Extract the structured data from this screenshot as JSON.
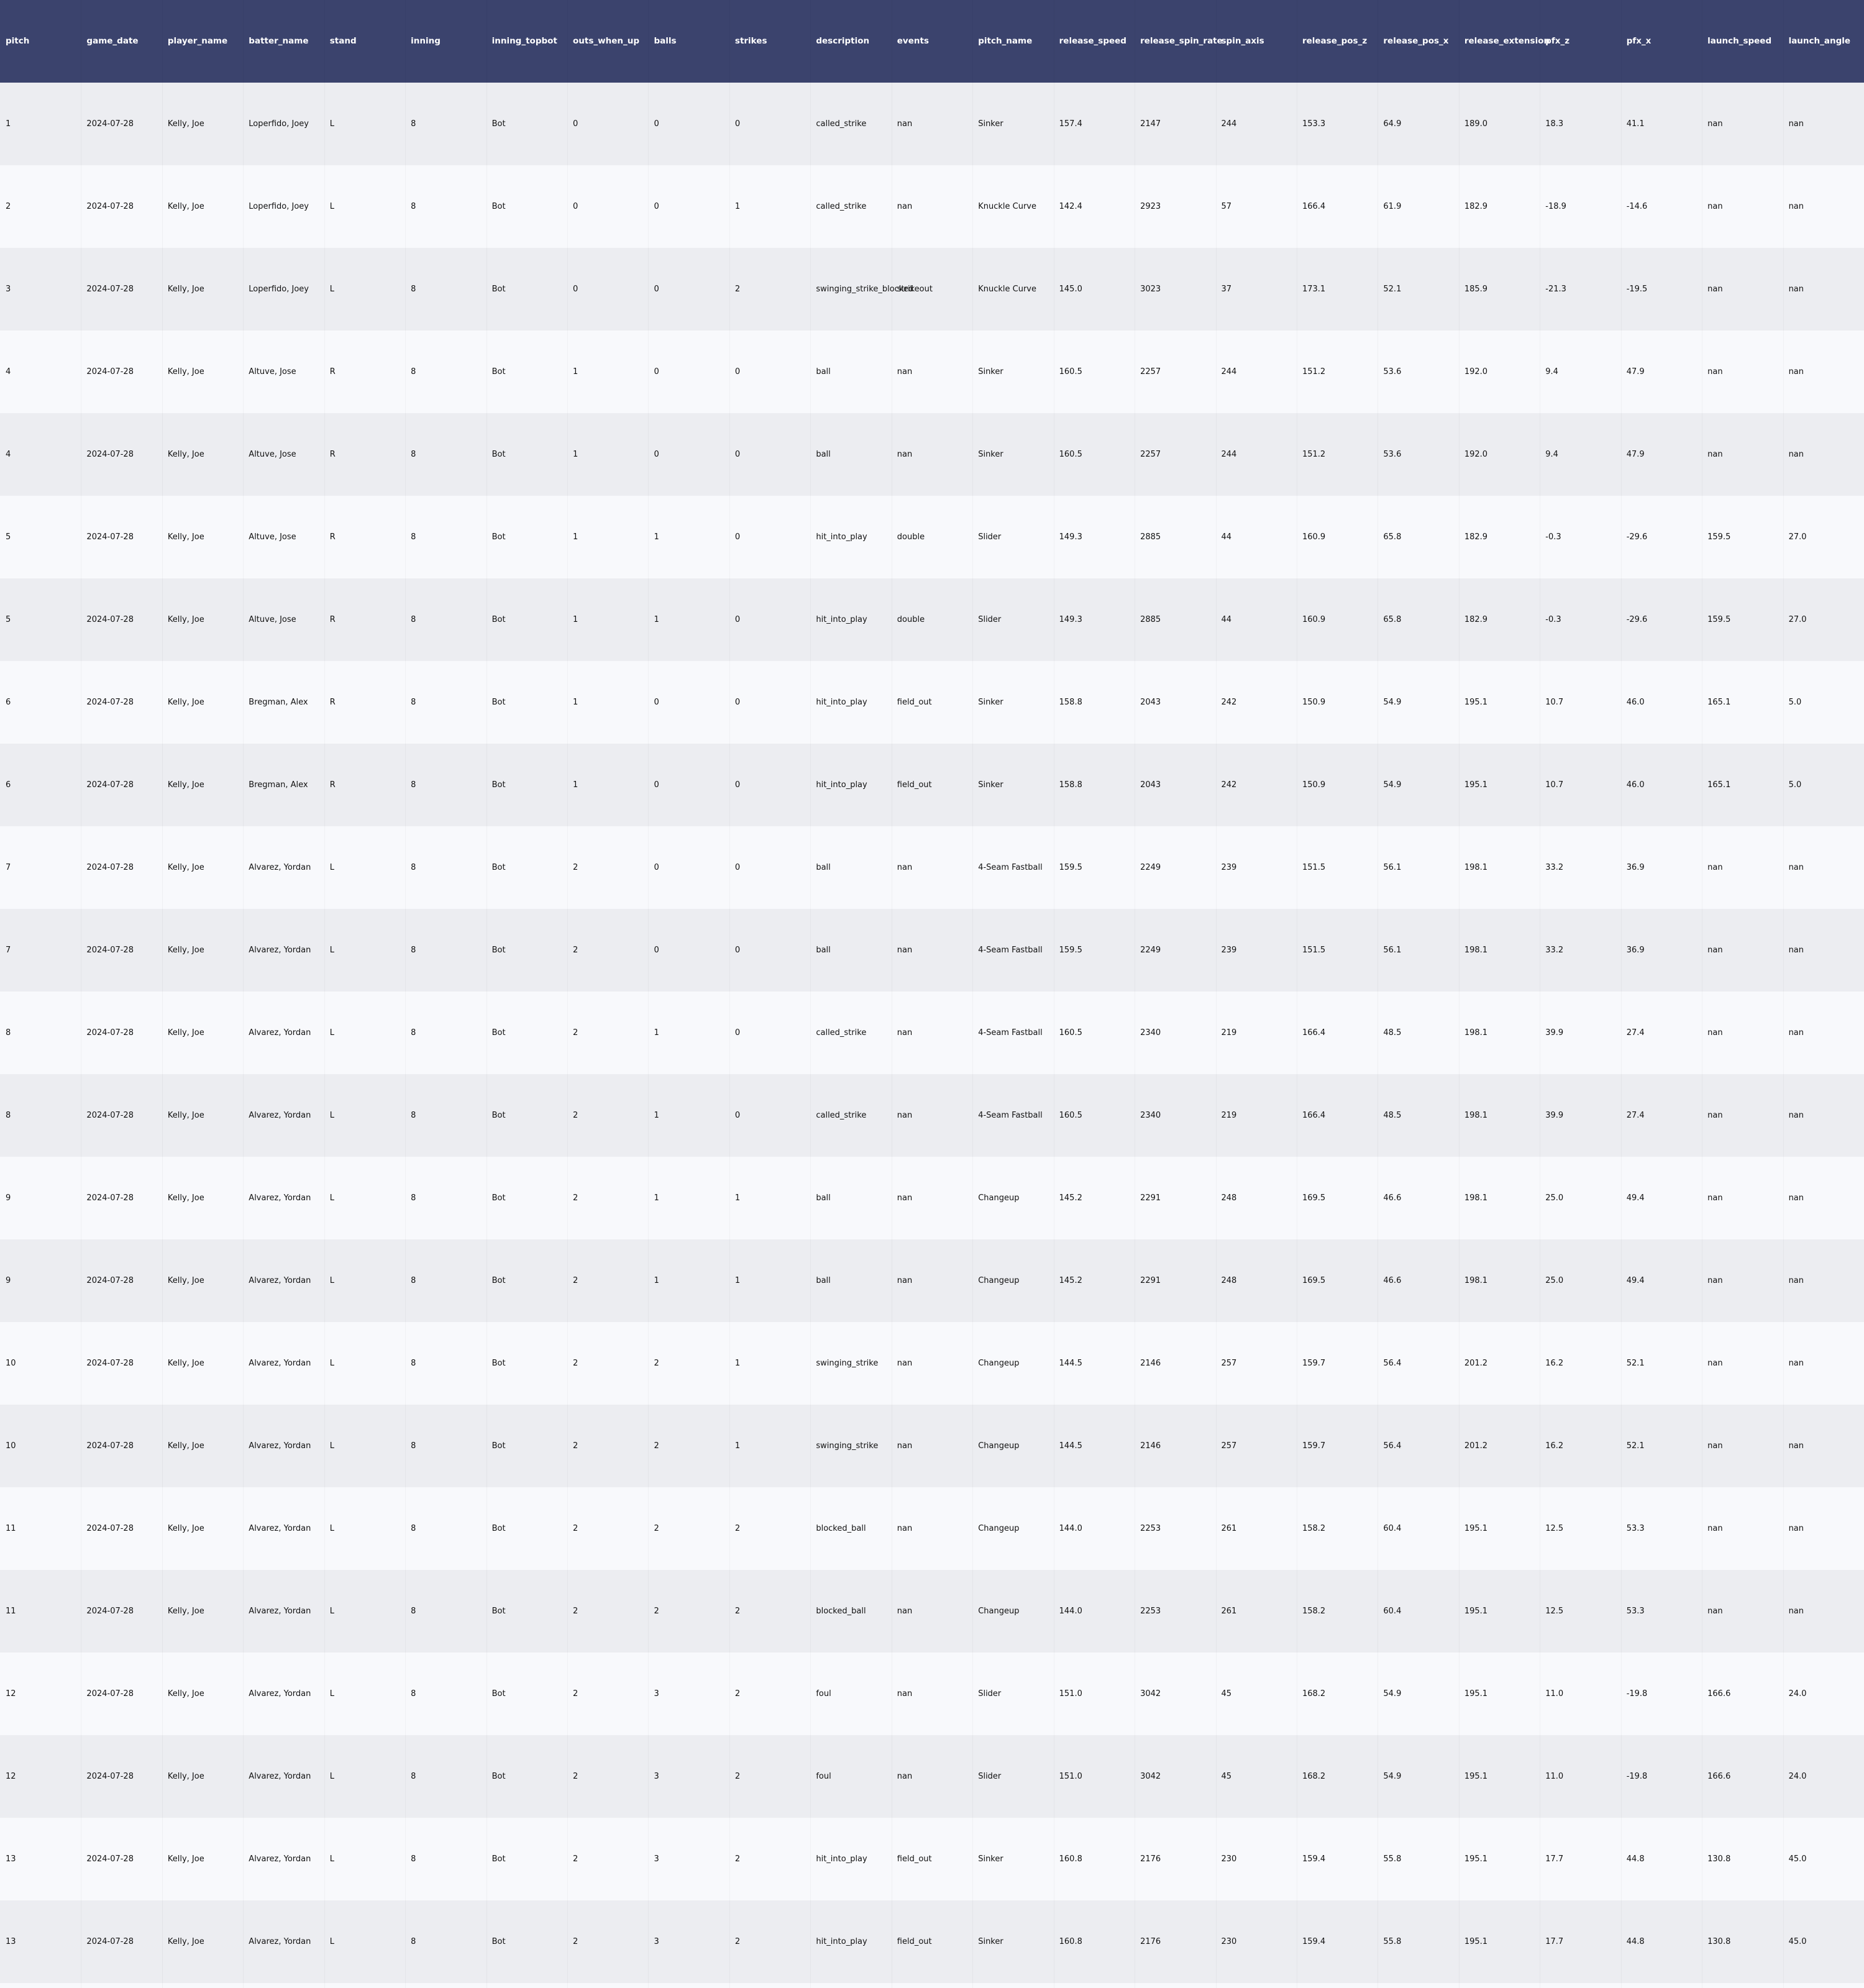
{
  "table": {
    "columns": [
      "pitch",
      "game_date",
      "player_name",
      "batter_name",
      "stand",
      "inning",
      "inning_topbot",
      "outs_when_up",
      "balls",
      "strikes",
      "description",
      "events",
      "pitch_name",
      "release_speed",
      "release_spin_rate",
      "spin_axis",
      "release_pos_z",
      "release_pos_x",
      "release_extension",
      "pfx_z",
      "pfx_x",
      "launch_speed",
      "launch_angle"
    ],
    "rows": [
      [
        "1",
        "2024-07-28",
        "Kelly, Joe",
        "Loperfido, Joey",
        "L",
        "8",
        "Bot",
        "0",
        "0",
        "0",
        "called_strike",
        "nan",
        "Sinker",
        "157.4",
        "2147",
        "244",
        "153.3",
        "64.9",
        "189.0",
        "18.3",
        "41.1",
        "nan",
        "nan"
      ],
      [
        "2",
        "2024-07-28",
        "Kelly, Joe",
        "Loperfido, Joey",
        "L",
        "8",
        "Bot",
        "0",
        "0",
        "1",
        "called_strike",
        "nan",
        "Knuckle Curve",
        "142.4",
        "2923",
        "57",
        "166.4",
        "61.9",
        "182.9",
        "-18.9",
        "-14.6",
        "nan",
        "nan"
      ],
      [
        "3",
        "2024-07-28",
        "Kelly, Joe",
        "Loperfido, Joey",
        "L",
        "8",
        "Bot",
        "0",
        "0",
        "2",
        "swinging_strike_blocked",
        "strikeout",
        "Knuckle Curve",
        "145.0",
        "3023",
        "37",
        "173.1",
        "52.1",
        "185.9",
        "-21.3",
        "-19.5",
        "nan",
        "nan"
      ],
      [
        "4",
        "2024-07-28",
        "Kelly, Joe",
        "Altuve, Jose",
        "R",
        "8",
        "Bot",
        "1",
        "0",
        "0",
        "ball",
        "nan",
        "Sinker",
        "160.5",
        "2257",
        "244",
        "151.2",
        "53.6",
        "192.0",
        "9.4",
        "47.9",
        "nan",
        "nan"
      ],
      [
        "4",
        "2024-07-28",
        "Kelly, Joe",
        "Altuve, Jose",
        "R",
        "8",
        "Bot",
        "1",
        "0",
        "0",
        "ball",
        "nan",
        "Sinker",
        "160.5",
        "2257",
        "244",
        "151.2",
        "53.6",
        "192.0",
        "9.4",
        "47.9",
        "nan",
        "nan"
      ],
      [
        "5",
        "2024-07-28",
        "Kelly, Joe",
        "Altuve, Jose",
        "R",
        "8",
        "Bot",
        "1",
        "1",
        "0",
        "hit_into_play",
        "double",
        "Slider",
        "149.3",
        "2885",
        "44",
        "160.9",
        "65.8",
        "182.9",
        "-0.3",
        "-29.6",
        "159.5",
        "27.0"
      ],
      [
        "5",
        "2024-07-28",
        "Kelly, Joe",
        "Altuve, Jose",
        "R",
        "8",
        "Bot",
        "1",
        "1",
        "0",
        "hit_into_play",
        "double",
        "Slider",
        "149.3",
        "2885",
        "44",
        "160.9",
        "65.8",
        "182.9",
        "-0.3",
        "-29.6",
        "159.5",
        "27.0"
      ],
      [
        "6",
        "2024-07-28",
        "Kelly, Joe",
        "Bregman, Alex",
        "R",
        "8",
        "Bot",
        "1",
        "0",
        "0",
        "hit_into_play",
        "field_out",
        "Sinker",
        "158.8",
        "2043",
        "242",
        "150.9",
        "54.9",
        "195.1",
        "10.7",
        "46.0",
        "165.1",
        "5.0"
      ],
      [
        "6",
        "2024-07-28",
        "Kelly, Joe",
        "Bregman, Alex",
        "R",
        "8",
        "Bot",
        "1",
        "0",
        "0",
        "hit_into_play",
        "field_out",
        "Sinker",
        "158.8",
        "2043",
        "242",
        "150.9",
        "54.9",
        "195.1",
        "10.7",
        "46.0",
        "165.1",
        "5.0"
      ],
      [
        "7",
        "2024-07-28",
        "Kelly, Joe",
        "Alvarez, Yordan",
        "L",
        "8",
        "Bot",
        "2",
        "0",
        "0",
        "ball",
        "nan",
        "4-Seam Fastball",
        "159.5",
        "2249",
        "239",
        "151.5",
        "56.1",
        "198.1",
        "33.2",
        "36.9",
        "nan",
        "nan"
      ],
      [
        "7",
        "2024-07-28",
        "Kelly, Joe",
        "Alvarez, Yordan",
        "L",
        "8",
        "Bot",
        "2",
        "0",
        "0",
        "ball",
        "nan",
        "4-Seam Fastball",
        "159.5",
        "2249",
        "239",
        "151.5",
        "56.1",
        "198.1",
        "33.2",
        "36.9",
        "nan",
        "nan"
      ],
      [
        "8",
        "2024-07-28",
        "Kelly, Joe",
        "Alvarez, Yordan",
        "L",
        "8",
        "Bot",
        "2",
        "1",
        "0",
        "called_strike",
        "nan",
        "4-Seam Fastball",
        "160.5",
        "2340",
        "219",
        "166.4",
        "48.5",
        "198.1",
        "39.9",
        "27.4",
        "nan",
        "nan"
      ],
      [
        "8",
        "2024-07-28",
        "Kelly, Joe",
        "Alvarez, Yordan",
        "L",
        "8",
        "Bot",
        "2",
        "1",
        "0",
        "called_strike",
        "nan",
        "4-Seam Fastball",
        "160.5",
        "2340",
        "219",
        "166.4",
        "48.5",
        "198.1",
        "39.9",
        "27.4",
        "nan",
        "nan"
      ],
      [
        "9",
        "2024-07-28",
        "Kelly, Joe",
        "Alvarez, Yordan",
        "L",
        "8",
        "Bot",
        "2",
        "1",
        "1",
        "ball",
        "nan",
        "Changeup",
        "145.2",
        "2291",
        "248",
        "169.5",
        "46.6",
        "198.1",
        "25.0",
        "49.4",
        "nan",
        "nan"
      ],
      [
        "9",
        "2024-07-28",
        "Kelly, Joe",
        "Alvarez, Yordan",
        "L",
        "8",
        "Bot",
        "2",
        "1",
        "1",
        "ball",
        "nan",
        "Changeup",
        "145.2",
        "2291",
        "248",
        "169.5",
        "46.6",
        "198.1",
        "25.0",
        "49.4",
        "nan",
        "nan"
      ],
      [
        "10",
        "2024-07-28",
        "Kelly, Joe",
        "Alvarez, Yordan",
        "L",
        "8",
        "Bot",
        "2",
        "2",
        "1",
        "swinging_strike",
        "nan",
        "Changeup",
        "144.5",
        "2146",
        "257",
        "159.7",
        "56.4",
        "201.2",
        "16.2",
        "52.1",
        "nan",
        "nan"
      ],
      [
        "10",
        "2024-07-28",
        "Kelly, Joe",
        "Alvarez, Yordan",
        "L",
        "8",
        "Bot",
        "2",
        "2",
        "1",
        "swinging_strike",
        "nan",
        "Changeup",
        "144.5",
        "2146",
        "257",
        "159.7",
        "56.4",
        "201.2",
        "16.2",
        "52.1",
        "nan",
        "nan"
      ],
      [
        "11",
        "2024-07-28",
        "Kelly, Joe",
        "Alvarez, Yordan",
        "L",
        "8",
        "Bot",
        "2",
        "2",
        "2",
        "blocked_ball",
        "nan",
        "Changeup",
        "144.0",
        "2253",
        "261",
        "158.2",
        "60.4",
        "195.1",
        "12.5",
        "53.3",
        "nan",
        "nan"
      ],
      [
        "11",
        "2024-07-28",
        "Kelly, Joe",
        "Alvarez, Yordan",
        "L",
        "8",
        "Bot",
        "2",
        "2",
        "2",
        "blocked_ball",
        "nan",
        "Changeup",
        "144.0",
        "2253",
        "261",
        "158.2",
        "60.4",
        "195.1",
        "12.5",
        "53.3",
        "nan",
        "nan"
      ],
      [
        "12",
        "2024-07-28",
        "Kelly, Joe",
        "Alvarez, Yordan",
        "L",
        "8",
        "Bot",
        "2",
        "3",
        "2",
        "foul",
        "nan",
        "Slider",
        "151.0",
        "3042",
        "45",
        "168.2",
        "54.9",
        "195.1",
        "11.0",
        "-19.8",
        "166.6",
        "24.0"
      ],
      [
        "12",
        "2024-07-28",
        "Kelly, Joe",
        "Alvarez, Yordan",
        "L",
        "8",
        "Bot",
        "2",
        "3",
        "2",
        "foul",
        "nan",
        "Slider",
        "151.0",
        "3042",
        "45",
        "168.2",
        "54.9",
        "195.1",
        "11.0",
        "-19.8",
        "166.6",
        "24.0"
      ],
      [
        "13",
        "2024-07-28",
        "Kelly, Joe",
        "Alvarez, Yordan",
        "L",
        "8",
        "Bot",
        "2",
        "3",
        "2",
        "hit_into_play",
        "field_out",
        "Sinker",
        "160.8",
        "2176",
        "230",
        "159.4",
        "55.8",
        "195.1",
        "17.7",
        "44.8",
        "130.8",
        "45.0"
      ],
      [
        "13",
        "2024-07-28",
        "Kelly, Joe",
        "Alvarez, Yordan",
        "L",
        "8",
        "Bot",
        "2",
        "3",
        "2",
        "hit_into_play",
        "field_out",
        "Sinker",
        "160.8",
        "2176",
        "230",
        "159.4",
        "55.8",
        "195.1",
        "17.7",
        "44.8",
        "130.8",
        "45.0"
      ]
    ]
  },
  "colors": {
    "header_bg": "#3b436d",
    "header_text": "#ffffff",
    "row_even_bg": "#ecedf1",
    "row_odd_bg": "#f8f9fc",
    "cell_text": "#111111"
  }
}
